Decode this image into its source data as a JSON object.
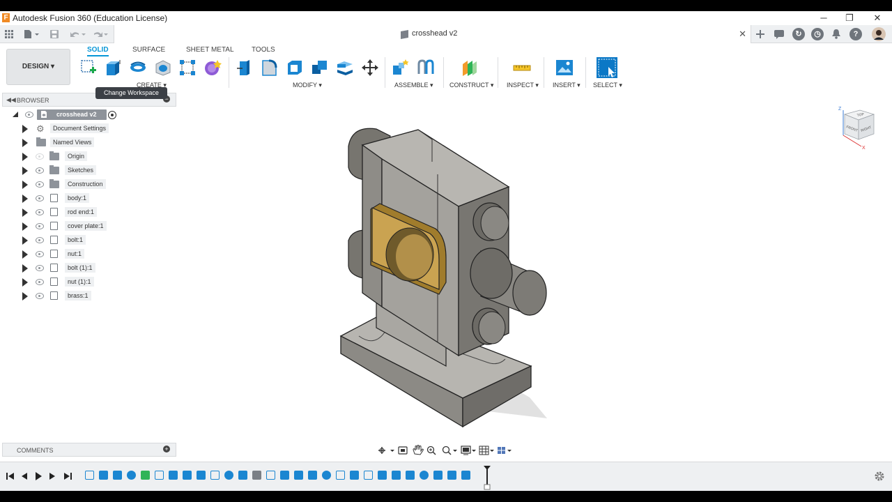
{
  "window": {
    "title": "Autodesk Fusion 360 (Education License)",
    "logo_letter": "F",
    "minimize": "─",
    "restore": "❐",
    "close": "✕"
  },
  "document": {
    "title": "crosshead v2",
    "close": "✕"
  },
  "ribbon": {
    "workspace_button": "DESIGN ▾",
    "tabs": [
      "SOLID",
      "SURFACE",
      "SHEET METAL",
      "TOOLS"
    ],
    "active_tab": "SOLID",
    "groups": [
      "CREATE ▾",
      "MODIFY ▾",
      "ASSEMBLE ▾",
      "CONSTRUCT ▾",
      "INSPECT ▾",
      "INSERT ▾",
      "SELECT ▾"
    ],
    "tooltip": "Change Workspace"
  },
  "browser": {
    "title": "BROWSER",
    "root": "crosshead v2",
    "items": [
      {
        "label": "Document Settings",
        "kind": "gear",
        "visible": true
      },
      {
        "label": "Named Views",
        "kind": "folder",
        "visible": true
      },
      {
        "label": "Origin",
        "kind": "folder",
        "visible": false
      },
      {
        "label": "Sketches",
        "kind": "folder",
        "visible": true
      },
      {
        "label": "Construction",
        "kind": "folder",
        "visible": true
      },
      {
        "label": "body:1",
        "kind": "body",
        "visible": true
      },
      {
        "label": "rod end:1",
        "kind": "body",
        "visible": true
      },
      {
        "label": "cover plate:1",
        "kind": "body",
        "visible": true
      },
      {
        "label": "bolt:1",
        "kind": "body",
        "visible": true
      },
      {
        "label": "nut:1",
        "kind": "body",
        "visible": true
      },
      {
        "label": "bolt (1):1",
        "kind": "body",
        "visible": true
      },
      {
        "label": "nut (1):1",
        "kind": "body",
        "visible": true
      },
      {
        "label": "brass:1",
        "kind": "body",
        "visible": true
      }
    ]
  },
  "comments": {
    "title": "COMMENTS"
  },
  "viewcube": {
    "top": "TOP",
    "front": "FRONT",
    "right": "RIGHT",
    "z": "Z",
    "x": "X"
  },
  "colors": {
    "accent": "#0696d7",
    "part_gray": "#8a8a86",
    "brass": "#c8a24a",
    "toolbar_bg": "#eef0f2"
  }
}
